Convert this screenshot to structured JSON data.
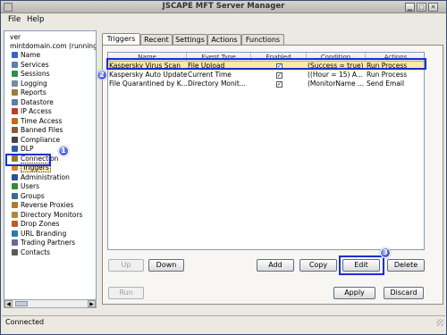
{
  "window": {
    "title": "JSCAPE MFT Server Manager",
    "controls": [
      "minimize",
      "maximize",
      "close"
    ]
  },
  "menu": [
    {
      "label": "File",
      "mnemonic": "F"
    },
    {
      "label": "Help",
      "mnemonic": "H"
    }
  ],
  "tree": {
    "root_label": "ver",
    "domain_label": "mintdomain.com (running)",
    "items": [
      {
        "label": "Name",
        "icon": "person-icon",
        "color": "#3a63c9"
      },
      {
        "label": "Services",
        "icon": "services-icon",
        "color": "#5c7fb0"
      },
      {
        "label": "Sessions",
        "icon": "sessions-icon",
        "color": "#2d8f4e"
      },
      {
        "label": "Logging",
        "icon": "logging-icon",
        "color": "#7a8aa0"
      },
      {
        "label": "Reports",
        "icon": "reports-icon",
        "color": "#9c7b3a"
      },
      {
        "label": "Datastore",
        "icon": "datastore-icon",
        "color": "#5a7fa8"
      },
      {
        "label": "IP Access",
        "icon": "ip-access-icon",
        "color": "#c0392b"
      },
      {
        "label": "Time Access",
        "icon": "time-access-icon",
        "color": "#c06a1a"
      },
      {
        "label": "Banned Files",
        "icon": "banned-files-icon",
        "color": "#8a5a3a"
      },
      {
        "label": "Compliance",
        "icon": "compliance-icon",
        "color": "#444"
      },
      {
        "label": "DLP",
        "icon": "dlp-icon",
        "color": "#2a5fb0"
      },
      {
        "label": "Connection",
        "icon": "connection-icon",
        "color": "#9a7a2a"
      },
      {
        "label": "Triggers",
        "icon": "triggers-icon",
        "color": "#d98a1a",
        "selected": true
      },
      {
        "label": "Administration",
        "icon": "administration-icon",
        "color": "#2a4f9a"
      },
      {
        "label": "Users",
        "icon": "users-icon",
        "color": "#3a8a3a"
      },
      {
        "label": "Groups",
        "icon": "groups-icon",
        "color": "#3a6a9a"
      },
      {
        "label": "Reverse Proxies",
        "icon": "reverse-proxies-icon",
        "color": "#b07a2a"
      },
      {
        "label": "Directory Monitors",
        "icon": "directory-monitors-icon",
        "color": "#b08a3a"
      },
      {
        "label": "Drop Zones",
        "icon": "drop-zones-icon",
        "color": "#c05a2a"
      },
      {
        "label": "URL Branding",
        "icon": "url-branding-icon",
        "color": "#2a7ab0"
      },
      {
        "label": "Trading Partners",
        "icon": "trading-partners-icon",
        "color": "#6a6a9a"
      },
      {
        "label": "Contacts",
        "icon": "contacts-icon",
        "color": "#5a5a5a"
      }
    ]
  },
  "tabs": [
    "Triggers",
    "Recent",
    "Settings",
    "Actions",
    "Functions"
  ],
  "active_tab": "Triggers",
  "table": {
    "columns": [
      "Name",
      "Event Type",
      "Enabled",
      "Condition",
      "Actions"
    ],
    "rows": [
      {
        "name": "Kaspersky Virus Scan",
        "event_type": "File Upload",
        "enabled": true,
        "condition": "(Success = true)",
        "actions": "Run Process",
        "selected": true
      },
      {
        "name": "Kaspersky Auto Update",
        "event_type": "Current Time",
        "enabled": true,
        "condition": "((Hour = 15) A...",
        "actions": "Run Process",
        "selected": false
      },
      {
        "name": "File Quarantined by K...",
        "event_type": "Directory Monit...",
        "enabled": true,
        "condition": "(MonitorName ...",
        "actions": "Send Email",
        "selected": false
      }
    ]
  },
  "buttons": {
    "up": "Up",
    "down": "Down",
    "add": "Add",
    "copy": "Copy",
    "edit": "Edit",
    "delete": "Delete",
    "run": "Run",
    "apply": "Apply",
    "discard": "Discard"
  },
  "callouts": [
    "1",
    "2",
    "3"
  ],
  "highlight_color": "#1b2fd0",
  "selection_color": "#fde8a8",
  "status": "Connected"
}
